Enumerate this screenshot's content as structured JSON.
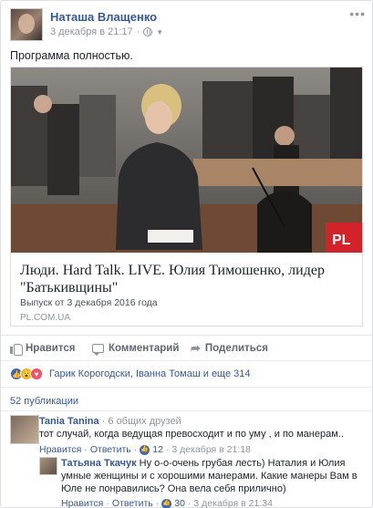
{
  "post": {
    "author": "Наташа Влащенко",
    "timestamp": "3 декабря в 21:17",
    "text": "Программа полностью."
  },
  "link": {
    "title": "Люди. Hard Talk. LIVE. Юлия Тимошенко, лидер \"Батькивщины\"",
    "description": "Выпуск от 3 декабря 2016 года",
    "domain": "PL.COM.UA",
    "image_logo": "PL"
  },
  "actions": {
    "like": "Нравится",
    "comment": "Комментарий",
    "share": "Поделиться"
  },
  "reactions": {
    "icons": [
      "like",
      "wow",
      "love"
    ],
    "names_text": "Гарик Корогодски, Іванна Томаш и еще 314"
  },
  "comments_count": "52 публикации",
  "comments": [
    {
      "author": "Tania Tanina",
      "subtitle": "· 6 общих друзей",
      "text": "тот случай, когда ведущая превосходит и по уму , и по манерам..",
      "like_label": "Нравится",
      "reply_label": "Ответить",
      "likes": "12",
      "time": "3 декабря в 21:18"
    }
  ],
  "reply": {
    "author": "Татьяна Ткачук",
    "text": "Ну о-о-очень грубая лесть) Наталия и Юлия умные женщины и с хорошими манерами. Какие манеры Вам в Юле не понравились? Она вела себя прилично)",
    "like_label": "Нравится",
    "reply_label": "Ответить",
    "likes": "30",
    "time": "3 декабря в 21:34"
  },
  "icons": {
    "globe": "globe-icon",
    "more": "more-icon",
    "like": "thumbs-up-icon",
    "comment": "comment-icon",
    "share": "share-icon"
  },
  "colors": {
    "link_blue": "#365899",
    "like_blue": "#4267b2",
    "muted": "#90949c"
  }
}
